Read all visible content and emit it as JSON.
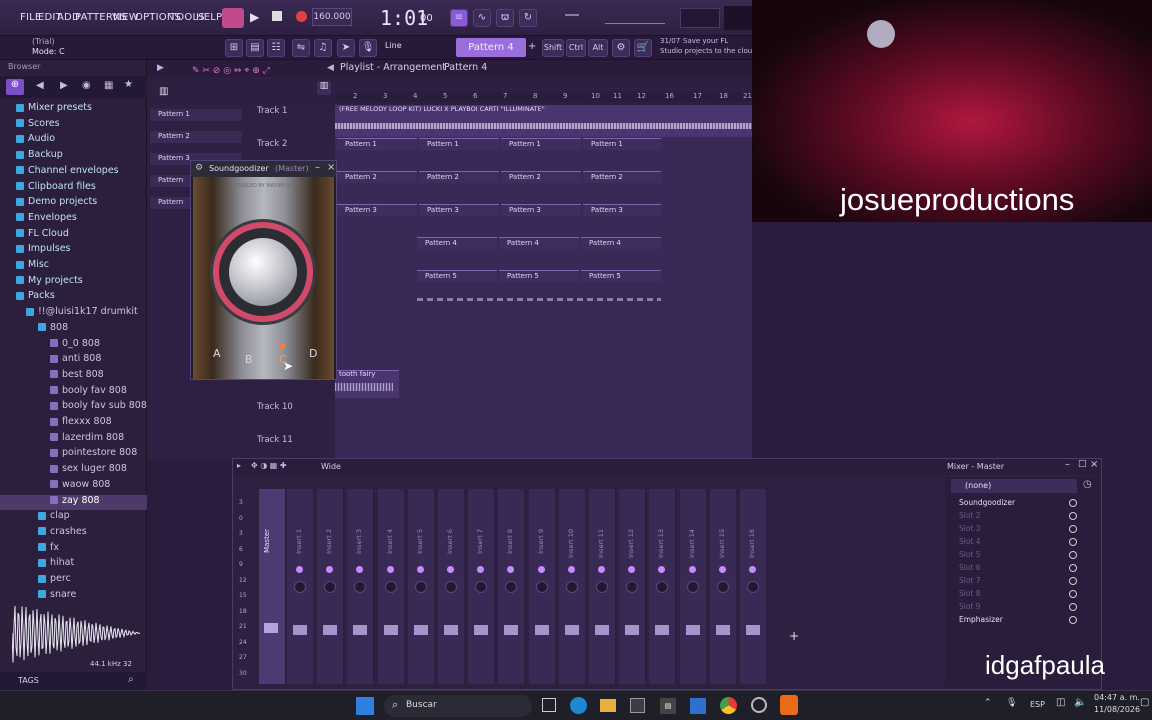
{
  "menu": {
    "file": "FILE",
    "edit": "EDIT",
    "add": "ADD",
    "patterns": "PATTERNS",
    "view": "VIEW",
    "options": "OPTIONS",
    "tools": "TOOLS",
    "help": "HELP"
  },
  "transport": {
    "tempo": "160.000",
    "time": "1:01",
    "time_sub": "00",
    "pattern": "Pattern 4",
    "mode_line": "Line",
    "shift": "Shift",
    "ctrl": "Ctrl",
    "alt": "Alt"
  },
  "hint": {
    "trial": "(Trial)",
    "mode": "Mode: C",
    "date_hint": "31/07",
    "hint_line1": "Save your FL",
    "hint_line2": "Studio projects to the cloud"
  },
  "browser": {
    "title": "Browser",
    "items": [
      {
        "label": "Mixer presets",
        "sub": false
      },
      {
        "label": "Scores",
        "sub": false
      },
      {
        "label": "Audio",
        "sub": false
      },
      {
        "label": "Backup",
        "sub": false
      },
      {
        "label": "Channel envelopes",
        "sub": false
      },
      {
        "label": "Clipboard files",
        "sub": false
      },
      {
        "label": "Demo projects",
        "sub": false
      },
      {
        "label": "Envelopes",
        "sub": false
      },
      {
        "label": "FL Cloud",
        "sub": false
      },
      {
        "label": "Impulses",
        "sub": false
      },
      {
        "label": "Misc",
        "sub": false
      },
      {
        "label": "My projects",
        "sub": false
      },
      {
        "label": "Packs",
        "sub": false
      },
      {
        "label": "!!@luisi1k17 drumkit",
        "sub": true
      },
      {
        "label": "808",
        "sub": true
      },
      {
        "label": "0_0 808",
        "sub": true
      },
      {
        "label": "anti 808",
        "sub": true
      },
      {
        "label": "best 808",
        "sub": true
      },
      {
        "label": "booly fav 808",
        "sub": true
      },
      {
        "label": "booly fav sub 808",
        "sub": true
      },
      {
        "label": "flexxx 808",
        "sub": true
      },
      {
        "label": "lazerdim 808",
        "sub": true
      },
      {
        "label": "pointestore 808",
        "sub": true
      },
      {
        "label": "sex luger 808",
        "sub": true
      },
      {
        "label": "waow 808",
        "sub": true
      },
      {
        "label": "zay 808",
        "sub": true
      },
      {
        "label": "clap",
        "sub": true
      },
      {
        "label": "crashes",
        "sub": true
      },
      {
        "label": "fx",
        "sub": true
      },
      {
        "label": "hihat",
        "sub": true
      },
      {
        "label": "perc",
        "sub": true
      },
      {
        "label": "snare",
        "sub": true
      }
    ],
    "wave_info": "44.1 kHz 32",
    "tags": "TAGS"
  },
  "playlist": {
    "title": "Playlist - Arrangement",
    "pattern_crumb": "Pattern 4",
    "audio_clip": "(FREE MELODY LOOP KIT) LUCKI X PLAYBOI CARTI \"ILLUMINATE\"",
    "tracks": [
      "Track 1",
      "Track 2",
      "Track 10",
      "Track 11"
    ],
    "patterns_list": [
      "Pattern 1",
      "Pattern 2",
      "Pattern 3",
      "Pattern",
      "Pattern"
    ],
    "clips": {
      "p1": "Pattern 1",
      "p2": "Pattern 2",
      "p3": "Pattern 3",
      "p4": "Pattern 4",
      "p5": "Pattern 5"
    },
    "tooth_clip": "tooth fairy"
  },
  "plugin": {
    "title": "Soundgoodizer",
    "channel": "(Master)",
    "brand_line": "FABLED BY MAXIMUS",
    "knob_labels": [
      "A",
      "B",
      "C",
      "D"
    ]
  },
  "mixer": {
    "title": "Mixer - Master",
    "preset": "Wide",
    "master_label": "Master",
    "inserts": [
      "Insert 1",
      "Insert 2",
      "Insert 3",
      "Insert 4",
      "Insert 5",
      "Insert 6",
      "Insert 7",
      "Insert 8",
      "Insert 9",
      "Insert 10",
      "Insert 11",
      "Insert 12",
      "Insert 13",
      "Insert 14",
      "Insert 15",
      "Insert 16"
    ],
    "db_marks": [
      "3",
      "0",
      "3",
      "6",
      "9",
      "12",
      "15",
      "18",
      "21",
      "24",
      "27",
      "30"
    ],
    "slot_none": "(none)",
    "slots": [
      "Soundgoodizer",
      "Slot 2",
      "Slot 3",
      "Slot 4",
      "Slot 5",
      "Slot 6",
      "Slot 7",
      "Slot 8",
      "Slot 9",
      "Emphasizer"
    ]
  },
  "overlay": {
    "webcam_name": "josueproductions",
    "bottom_name": "idgafpaula"
  },
  "taskbar": {
    "search": "Buscar",
    "lang": "ESP",
    "time": "04:47 a. m.",
    "date": "11/08/2026"
  },
  "colors": {
    "accent": "#7b4fc8",
    "bg": "#2b1c3d",
    "record": "#e34040",
    "play": "#b8e08a"
  }
}
